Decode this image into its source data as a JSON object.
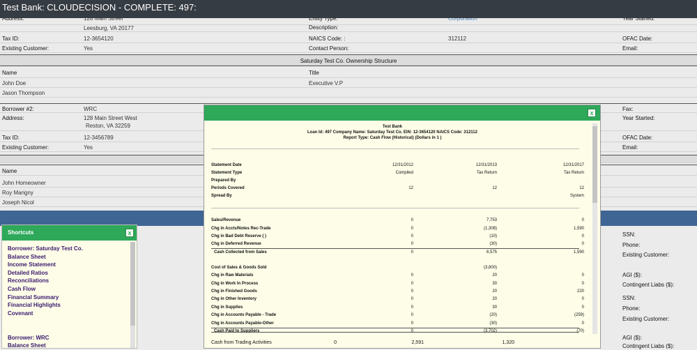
{
  "window": {
    "title": "Test Bank: CLOUDECISION - COMPLETE: 497:"
  },
  "borrower1": {
    "address_label": "Address:",
    "address_line1": "128 Main Street",
    "address_line2": "Leesburg, VA 20177",
    "entity_label": "Entity Type:",
    "entity_value": "Corporation",
    "year_label": "Year Started:",
    "description_label": "Description:",
    "tax_label": "Tax ID:",
    "tax_value": "12-3654120",
    "naics_label": "NAICS Code: :",
    "naics_value": "312112",
    "ofac_label": "OFAC Date:",
    "existing_label": "Existing Customer:",
    "existing_value": "Yes",
    "contact_label": "Contact Person:",
    "email_label": "Email:"
  },
  "ownership": {
    "title": "Saturday Test Co. Ownership Structure",
    "name_header": "Name",
    "title_header": "Title",
    "rows": [
      {
        "name": "John Doe",
        "title": "Executive V.P"
      },
      {
        "name": "Jason Thompson",
        "title": ""
      }
    ]
  },
  "borrower2": {
    "label": "Borrower #2:",
    "value": "WRC",
    "fax_label": "Fax:",
    "address_label": "Address:",
    "address_line1": "128 Main Street West",
    "address_line2": "Reston, VA 32259",
    "year_label": "Year Started:",
    "tax_label": "Tax ID:",
    "tax_value": "12-3456789",
    "ofac_label": "OFAC Date:",
    "existing_label": "Existing Customer:",
    "existing_value": "Yes",
    "email_label": "Email:"
  },
  "owners2": {
    "name_header": "Name",
    "rows": [
      "John Homeowner",
      "Roy Marigny",
      "Joseph Nicol"
    ]
  },
  "right_panel": {
    "ssn": "SSN:",
    "phone": "Phone:",
    "existing": "Existing Customer:",
    "agi": "AGI ($):",
    "contingent": "Contingent Liabs ($):",
    "ssn2": "SSN:",
    "phone2": "Phone:",
    "existing2": "Existing Customer:",
    "agi2": "AGI ($):",
    "contingent2": "Contingent Liabs ($):"
  },
  "shortcuts": {
    "title": "Shortcuts",
    "close": "x",
    "items": [
      "Borrower: Saturday Test Co.",
      "Balance Sheet",
      "Income Statement",
      "Detailed Ratios",
      "Reconciliations",
      "Cash Flow",
      "Financial Summary",
      "Financial Highlights",
      "Covenant",
      "",
      "",
      "Borrower: WRC",
      "Balance Sheet"
    ]
  },
  "report": {
    "close": "x",
    "bank": "Test Bank",
    "line2": "Loan Id: 497  Company Name: Saturday Test Co.  EIN: 12-3654120  NAICS Code: 312112",
    "line3": "Report Type: Cash Flow (Historical)  (Dollars in 1 )",
    "header_rows": [
      {
        "k": "Statement Date",
        "v": [
          "12/31/2012",
          "12/31/2013",
          "12/31/2017"
        ]
      },
      {
        "k": "Statement Type",
        "v": [
          "Compiled",
          "Tax Return",
          "Tax Return"
        ]
      },
      {
        "k": "Prepared By",
        "v": [
          "",
          "",
          ""
        ]
      },
      {
        "k": "Periods Covered",
        "v": [
          "12",
          "12",
          "12"
        ]
      },
      {
        "k": "Spread By",
        "v": [
          "",
          "",
          "System"
        ]
      }
    ],
    "rows": [
      {
        "k": "Sales/Revenue",
        "v": [
          "0",
          "7,753",
          "0"
        ]
      },
      {
        "k": "Chg in Accts/Notes Rec-Trade",
        "v": [
          "0",
          "(1,308)",
          "1,590"
        ]
      },
      {
        "k": "Chg in Bad Debt Reserve ( )",
        "v": [
          "0",
          "(10)",
          "0"
        ]
      },
      {
        "k": "Chg in Deferred Revenue",
        "v": [
          "0",
          "(30)",
          "0"
        ]
      },
      {
        "k": "Cash Collected from Sales",
        "v": [
          "0",
          "6,575",
          "1,590"
        ]
      },
      {
        "k": "Cost of Sales & Goods Sold",
        "v": [
          "",
          "(3,800)",
          ""
        ]
      },
      {
        "k": "Chg in Raw Materials",
        "v": [
          "0",
          "20",
          "0"
        ]
      },
      {
        "k": "Chg in Work In Process",
        "v": [
          "0",
          "30",
          "0"
        ]
      },
      {
        "k": "Chg in Finished Goods",
        "v": [
          "0",
          "20",
          "220"
        ]
      },
      {
        "k": "Chg in Other Inventory",
        "v": [
          "0",
          "20",
          "0"
        ]
      },
      {
        "k": "Chg in Supplies",
        "v": [
          "0",
          "30",
          "0"
        ]
      },
      {
        "k": "Chg in Accounts Payable - Trade",
        "v": [
          "0",
          "(20)",
          "(259)"
        ]
      },
      {
        "k": "Chg in Accounts Payable-Other",
        "v": [
          "0",
          "(30)",
          "0"
        ]
      },
      {
        "k": "Cash Paid to Suppliers",
        "v": [
          "0",
          "(3,702)",
          "(70)"
        ]
      }
    ],
    "last_row": {
      "k": "Cash from Trading Activities",
      "v": [
        "0",
        "2,591",
        "1,320"
      ]
    }
  }
}
